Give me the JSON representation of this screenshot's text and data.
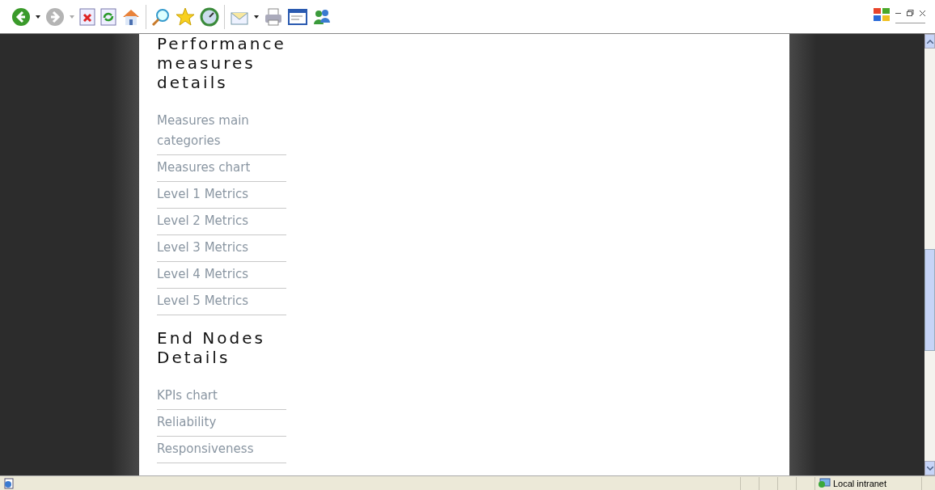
{
  "sections": [
    {
      "heading": "Performance measures details",
      "links": [
        "Measures main categories",
        "Measures chart",
        "Level 1 Metrics",
        "Level 2 Metrics",
        "Level 3 Metrics",
        "Level 4 Metrics",
        "Level 5 Metrics"
      ]
    },
    {
      "heading": "End Nodes Details",
      "links": [
        "KPIs chart",
        "Reliability",
        "Responsiveness"
      ]
    }
  ],
  "status_bar": {
    "zone": "Local intranet"
  }
}
